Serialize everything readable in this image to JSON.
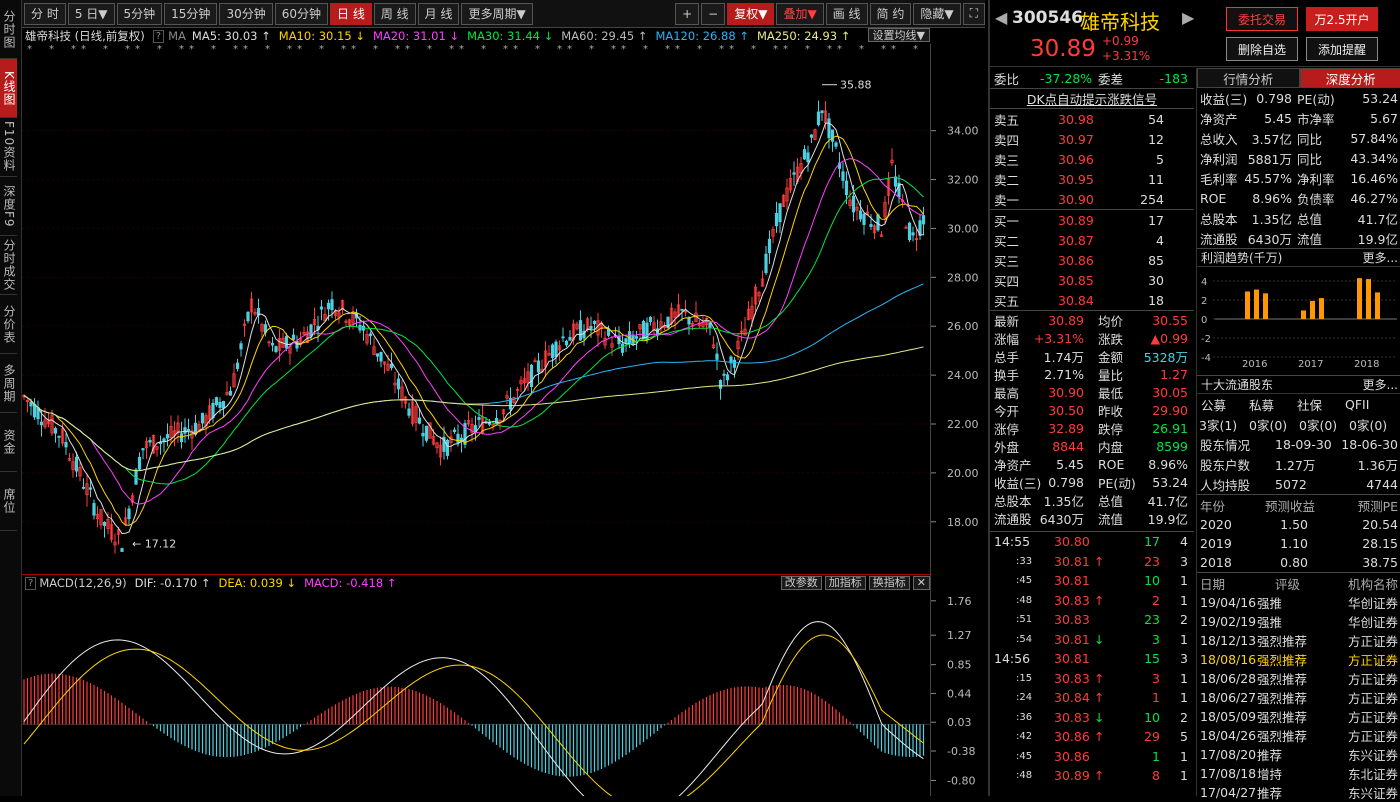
{
  "side_tabs": [
    "分时图",
    "K线图",
    "F10资料",
    "深度F9",
    "分时成交",
    "分价表",
    "多周期",
    "资金",
    "席位"
  ],
  "top_tabs": [
    "分 时",
    "5 日▼",
    "5分钟",
    "15分钟",
    "30分钟",
    "60分钟",
    "日 线",
    "周 线",
    "月 线",
    "更多周期▼"
  ],
  "top_tools": [
    "+",
    "−",
    "复权▼",
    "叠加▼",
    "画 线",
    "简 约",
    "隐藏▼"
  ],
  "chart_head": {
    "name": "雄帝科技 (日线,前复权)",
    "ma": "MA",
    "ma5": "MA5: 30.03 ↑",
    "ma10": "MA10: 30.15 ↓",
    "ma20": "MA20: 31.01 ↓",
    "ma30": "MA30: 31.44 ↓",
    "ma60": "MA60: 29.45 ↑",
    "ma120": "MA120: 26.88 ↑",
    "ma250": "MA250: 24.93 ↑",
    "set": "设置均线▼"
  },
  "y_ticks": [
    "34.00",
    "32.00",
    "30.00",
    "28.00",
    "26.00",
    "24.00",
    "22.00",
    "20.00",
    "18.00"
  ],
  "hi_label": "35.88",
  "lo_label": "17.12",
  "macd_head": {
    "name": "MACD(12,26,9)",
    "dif": "DIF: -0.170 ↑",
    "dea": "DEA: 0.039 ↓",
    "macd": "MACD: -0.418 ↑",
    "b1": "改参数",
    "b2": "加指标",
    "b3": "换指标"
  },
  "macd_ticks": [
    "1.76",
    "1.27",
    "0.85",
    "0.44",
    "0.03",
    "-0.38",
    "-0.80"
  ],
  "stock": {
    "code": "300546",
    "name": "雄帝科技",
    "price": "30.89",
    "chg": "+0.99",
    "pct": "+3.31%"
  },
  "buttons": {
    "trade": "委托交易",
    "open": "万2.5开户",
    "del": "删除自选",
    "warn": "添加提醒"
  },
  "wb": {
    "l1": "委比",
    "v1": "-37.28%",
    "l2": "委差",
    "v2": "-183"
  },
  "dk": "DK点自动提示涨跌信号",
  "sell": [
    [
      "卖五",
      "30.98",
      "54"
    ],
    [
      "卖四",
      "30.97",
      "12"
    ],
    [
      "卖三",
      "30.96",
      "5"
    ],
    [
      "卖二",
      "30.95",
      "11"
    ],
    [
      "卖一",
      "30.90",
      "254"
    ]
  ],
  "buy": [
    [
      "买一",
      "30.89",
      "17"
    ],
    [
      "买二",
      "30.87",
      "4"
    ],
    [
      "买三",
      "30.86",
      "85"
    ],
    [
      "买四",
      "30.85",
      "30"
    ],
    [
      "买五",
      "30.84",
      "18"
    ]
  ],
  "quote": [
    [
      "最新",
      "30.89",
      "均价",
      "30.55"
    ],
    [
      "涨幅",
      "+3.31%",
      "涨跌",
      "▲0.99"
    ],
    [
      "总手",
      "1.74万",
      "金额",
      "5328万"
    ],
    [
      "换手",
      "2.71%",
      "量比",
      "1.27"
    ],
    [
      "最高",
      "30.90",
      "最低",
      "30.05"
    ],
    [
      "今开",
      "30.50",
      "昨收",
      "29.90"
    ],
    [
      "涨停",
      "32.89",
      "跌停",
      "26.91"
    ],
    [
      "外盘",
      "8844",
      "内盘",
      "8599"
    ],
    [
      "净资产",
      "5.45",
      "ROE",
      "8.96%"
    ],
    [
      "收益(三)",
      "0.798",
      "PE(动)",
      "53.24"
    ],
    [
      "总股本",
      "1.35亿",
      "总值",
      "41.7亿"
    ],
    [
      "流通股",
      "6430万",
      "流值",
      "19.9亿"
    ]
  ],
  "ticks": [
    [
      "14:55",
      "30.80",
      "",
      "17",
      "4"
    ],
    [
      ":33",
      "30.81",
      "↑",
      "23",
      "3"
    ],
    [
      ":45",
      "30.81",
      "",
      "10",
      "1"
    ],
    [
      ":48",
      "30.83",
      "↑",
      "2",
      "1"
    ],
    [
      ":51",
      "30.83",
      "",
      "23",
      "2"
    ],
    [
      ":54",
      "30.81",
      "↓",
      "3",
      "1"
    ],
    [
      "14:56",
      "30.81",
      "",
      "15",
      "3"
    ],
    [
      ":15",
      "30.83",
      "↑",
      "3",
      "1"
    ],
    [
      ":24",
      "30.84",
      "↑",
      "1",
      "1"
    ],
    [
      ":36",
      "30.83",
      "↓",
      "10",
      "2"
    ],
    [
      ":42",
      "30.86",
      "↑",
      "29",
      "5"
    ],
    [
      ":45",
      "30.86",
      "",
      "1",
      "1"
    ],
    [
      ":48",
      "30.89",
      "↑",
      "8",
      "1"
    ]
  ],
  "fin_tabs": [
    "行情分析",
    "深度分析"
  ],
  "fin": [
    [
      "收益(三)",
      "0.798",
      "PE(动)",
      "53.24"
    ],
    [
      "净资产",
      "5.45",
      "市净率",
      "5.67"
    ],
    [
      "总收入",
      "3.57亿",
      "同比",
      "57.84%"
    ],
    [
      "净利润",
      "5881万",
      "同比",
      "43.34%"
    ],
    [
      "毛利率",
      "45.57%",
      "净利率",
      "16.46%"
    ],
    [
      "ROE",
      "8.96%",
      "负债率",
      "46.27%"
    ],
    [
      "总股本",
      "1.35亿",
      "总值",
      "41.7亿"
    ],
    [
      "流通股",
      "6430万",
      "流值",
      "19.9亿"
    ]
  ],
  "profit": {
    "title": "利润趋势(千万)",
    "more": "更多...",
    "years": [
      "2016",
      "2017",
      "2018"
    ],
    "yt": [
      "4",
      "2",
      "0",
      "-2",
      "-4"
    ],
    "bars": [
      2.9,
      3.1,
      2.7,
      0.9,
      1.9,
      2.2,
      4.3,
      4.2,
      2.8
    ]
  },
  "holders": {
    "title": "十大流通股东",
    "more": "更多...",
    "cols": [
      "公募",
      "私募",
      "社保",
      "QFII"
    ],
    "vals": [
      "3家(1)",
      "0家(0)",
      "0家(0)",
      "0家(0)"
    ],
    "r1": [
      "股东情况",
      "18-09-30",
      "18-06-30"
    ],
    "r2": [
      "股东户数",
      "1.27万",
      "1.36万"
    ],
    "r3": [
      "人均持股",
      "5072",
      "4744"
    ]
  },
  "forecast": {
    "cols": [
      "年份",
      "预测收益",
      "预测PE"
    ],
    "rows": [
      [
        "2020",
        "1.50",
        "20.54"
      ],
      [
        "2019",
        "1.10",
        "28.15"
      ],
      [
        "2018",
        "0.80",
        "38.75"
      ]
    ]
  },
  "ratings": {
    "cols": [
      "日期",
      "评级",
      "机构名称"
    ],
    "rows": [
      [
        "19/04/16",
        "强推",
        "华创证券"
      ],
      [
        "19/02/19",
        "强推",
        "华创证券"
      ],
      [
        "18/12/13",
        "强烈推荐",
        "方正证券"
      ],
      [
        "18/08/16",
        "强烈推荐",
        "方正证券"
      ],
      [
        "18/06/28",
        "强烈推荐",
        "方正证券"
      ],
      [
        "18/06/27",
        "强烈推荐",
        "方正证券"
      ],
      [
        "18/05/09",
        "强烈推荐",
        "方正证券"
      ],
      [
        "18/04/26",
        "强烈推荐",
        "方正证券"
      ],
      [
        "17/08/20",
        "推荐",
        "东兴证券"
      ],
      [
        "17/08/18",
        "增持",
        "东北证券"
      ],
      [
        "17/04/27",
        "推荐",
        "东兴证券"
      ]
    ]
  }
}
